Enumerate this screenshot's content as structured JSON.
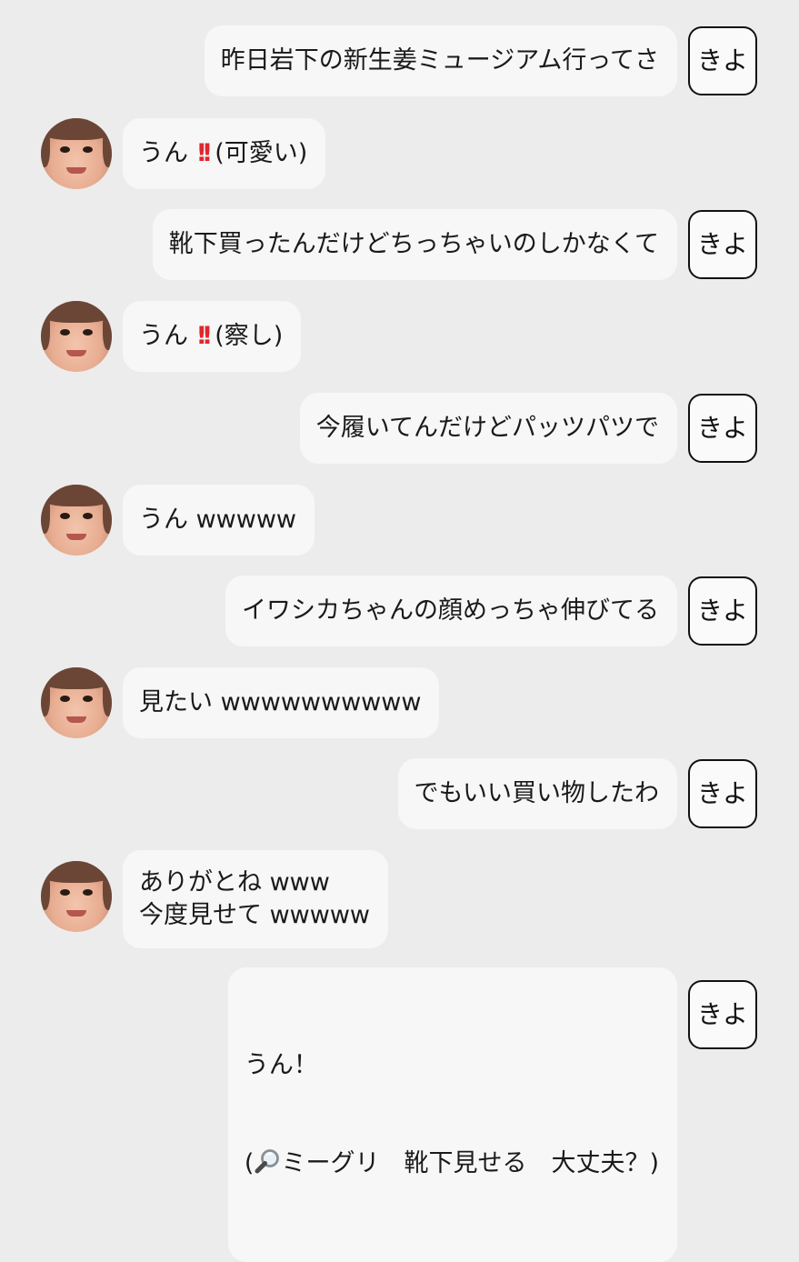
{
  "sender_tag": "きよ",
  "messages": [
    {
      "side": "right",
      "text": "昨日岩下の新生姜ミュージアム行ってさ"
    },
    {
      "side": "left",
      "prefix": "うん",
      "suffix": "(可愛い)"
    },
    {
      "side": "right",
      "text": "靴下買ったんだけどちっちゃいのしかなくて"
    },
    {
      "side": "left",
      "prefix": "うん",
      "suffix": "(察し)"
    },
    {
      "side": "right",
      "text": "今履いてんだけどパッツパツで"
    },
    {
      "side": "left",
      "text": "うん wwwww"
    },
    {
      "side": "right",
      "text": "イワシカちゃんの顔めっちゃ伸びてる"
    },
    {
      "side": "left",
      "text": "見たい wwwwwwwwww"
    },
    {
      "side": "right",
      "text": "でもいい買い物したわ"
    },
    {
      "side": "left",
      "line1": "ありがとね www",
      "line2": "今度見せて wwwww"
    },
    {
      "side": "right",
      "line1": "うん！",
      "line2_open": "(",
      "line2_rest": "ミーグリ　靴下見せる　大丈夫？)"
    }
  ],
  "colors": {
    "background": "#ececec",
    "bubble": "#f7f7f7",
    "exclamation": "#e0262d"
  },
  "icons": {
    "exclamation": "double-exclamation-icon",
    "search": "magnifier-icon",
    "avatar": "user-avatar"
  }
}
